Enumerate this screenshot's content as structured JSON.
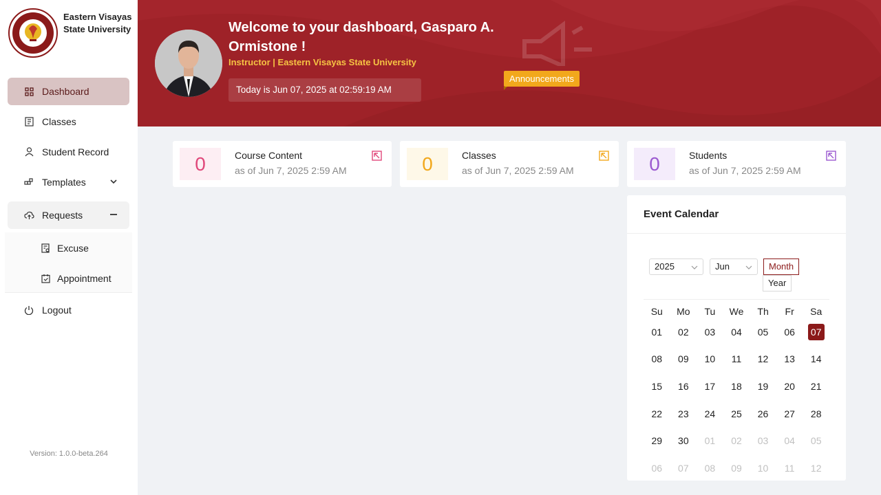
{
  "brand": {
    "name_line1": "Eastern Visayas",
    "name_line2": "State University",
    "seal_text": "EASTERN VISAYAS STATE UNIVERSITY",
    "seal_year": "1907"
  },
  "nav": {
    "dashboard": "Dashboard",
    "classes": "Classes",
    "student_record": "Student Record",
    "templates": "Templates",
    "requests": "Requests",
    "excuse": "Excuse",
    "appointment": "Appointment",
    "logout": "Logout"
  },
  "version": "Version: 1.0.0-beta.264",
  "banner": {
    "welcome": "Welcome to your dashboard, Gasparo A. Ormistone !",
    "role": "Instructor | Eastern Visayas State University",
    "today": "Today is Jun 07, 2025 at 02:59:19 AM",
    "announcements": "Announcements"
  },
  "cards": [
    {
      "value": "0",
      "title": "Course Content",
      "asof": "as of Jun 7, 2025 2:59 AM",
      "color": "#e0487a",
      "bg": "#fdeef3"
    },
    {
      "value": "0",
      "title": "Classes",
      "asof": "as of Jun 7, 2025 2:59 AM",
      "color": "#f2a81c",
      "bg": "#fef8e8"
    },
    {
      "value": "0",
      "title": "Students",
      "asof": "as of Jun 7, 2025 2:59 AM",
      "color": "#9b59d0",
      "bg": "#f4ecfb"
    }
  ],
  "calendar": {
    "title": "Event Calendar",
    "year": "2025",
    "month": "Jun",
    "mode_month": "Month",
    "mode_year": "Year",
    "weekdays": [
      "Su",
      "Mo",
      "Tu",
      "We",
      "Th",
      "Fr",
      "Sa"
    ],
    "weeks": [
      [
        "01",
        "02",
        "03",
        "04",
        "05",
        "06",
        "07"
      ],
      [
        "08",
        "09",
        "10",
        "11",
        "12",
        "13",
        "14"
      ],
      [
        "15",
        "16",
        "17",
        "18",
        "19",
        "20",
        "21"
      ],
      [
        "22",
        "23",
        "24",
        "25",
        "26",
        "27",
        "28"
      ],
      [
        "29",
        "30",
        "01",
        "02",
        "03",
        "04",
        "05"
      ],
      [
        "06",
        "07",
        "08",
        "09",
        "10",
        "11",
        "12"
      ]
    ],
    "today": "07"
  },
  "colors": {
    "primary": "#9e2228",
    "accent": "#f2a81c",
    "selected": "#8b1a1a"
  }
}
